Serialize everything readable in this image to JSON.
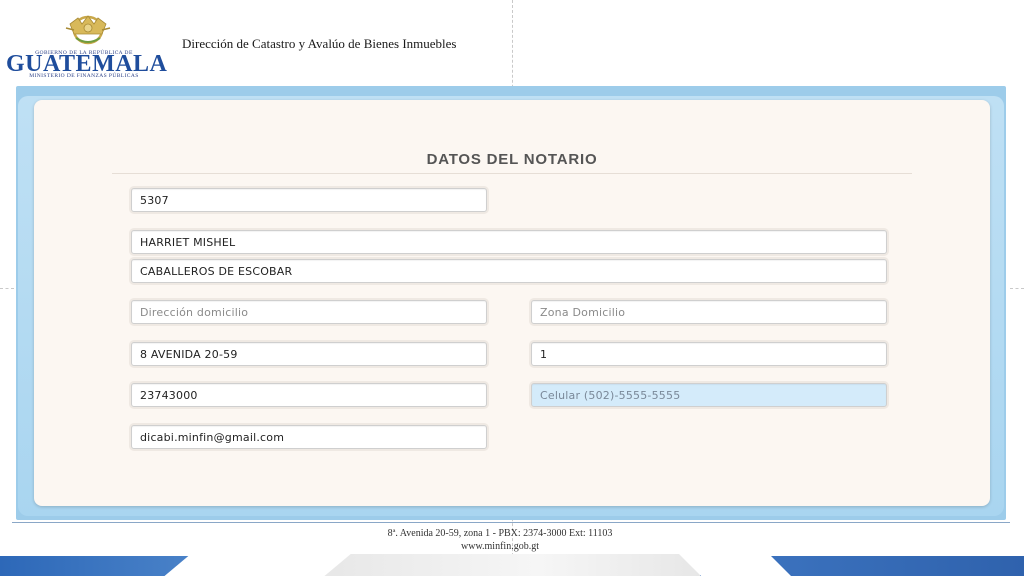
{
  "header": {
    "logo": {
      "gov_line": "GOBIERNO DE LA REPÚBLICA DE",
      "wordmark": "GUATEMALA",
      "ministry_line": "MINISTERIO DE FINANZAS PÚBLICAS",
      "emblem_icon": "coat-of-arms-icon"
    },
    "department": "Dirección de Catastro y Avalúo de Bienes Inmuebles"
  },
  "form": {
    "title": "DATOS DEL NOTARIO",
    "fields": {
      "colegiado": {
        "value": "5307",
        "placeholder": ""
      },
      "nombres": {
        "value": "HARRIET MISHEL",
        "placeholder": ""
      },
      "apellidos": {
        "value": "CABALLEROS DE ESCOBAR",
        "placeholder": ""
      },
      "direccion_domicilio": {
        "value": "",
        "placeholder": "Dirección domicilio"
      },
      "zona_domicilio": {
        "value": "",
        "placeholder": "Zona Domicilio"
      },
      "direccion_oficina": {
        "value": "8 AVENIDA 20-59",
        "placeholder": ""
      },
      "zona_oficina": {
        "value": "1",
        "placeholder": ""
      },
      "telefono": {
        "value": "23743000",
        "placeholder": ""
      },
      "celular": {
        "value": "",
        "placeholder": "Celular (502)-5555-5555"
      },
      "email": {
        "value": "dicabi.minfin@gmail.com",
        "placeholder": ""
      }
    }
  },
  "footer": {
    "address": "8ª. Avenida 20-59, zona 1 -  PBX: 2374-3000  Ext: 11103",
    "website": "www.minfin.gob.gt"
  },
  "colors": {
    "frame_blue": "#9dccea",
    "logo_blue": "#1f4d9c",
    "emblem_gold": "#c9a84a",
    "footer_blue": "#2d68b8",
    "highlight_field": "#d4ebfa"
  }
}
